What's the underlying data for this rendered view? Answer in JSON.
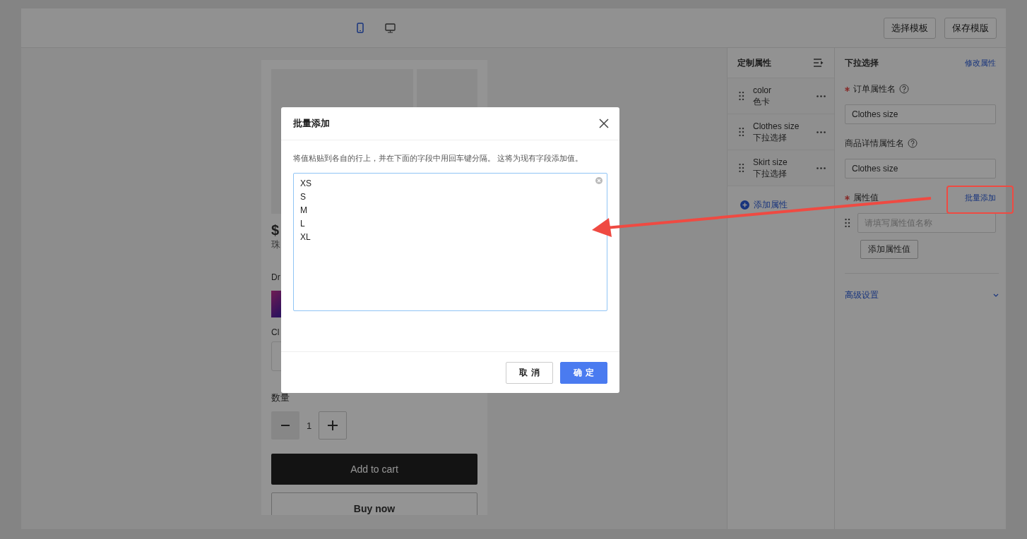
{
  "header": {
    "device_toggle": [
      {
        "kind": "mobile",
        "selected": true
      },
      {
        "kind": "desktop",
        "selected": false
      }
    ],
    "buttons": [
      "选择模板",
      "保存模版"
    ]
  },
  "preview": {
    "price": "$",
    "subtitle": "珠",
    "option_label_1": "Dr",
    "option_label_2": "Cl",
    "quantity_label": "数量",
    "quantity": "1",
    "add_to_cart": "Add to cart",
    "buy_now": "Buy now"
  },
  "attributes_panel": {
    "title": "定制属性",
    "items": [
      {
        "name": "color",
        "type": "色卡"
      },
      {
        "name": "Clothes size",
        "type": "下拉选择"
      },
      {
        "name": "Skirt size",
        "type": "下拉选择"
      }
    ],
    "add_button": "添加属性"
  },
  "settings": {
    "title": "下拉选择",
    "edit_link": "修改属性",
    "fields": [
      {
        "label": "订单属性名",
        "required": true,
        "help": true,
        "value": "Clothes size"
      },
      {
        "label": "商品详情属性名",
        "required": false,
        "help": true,
        "value": "Clothes size"
      }
    ],
    "values_label": "属性值",
    "values_required": true,
    "batch_link": "批量添加",
    "value_placeholder": "请填写属性值名称",
    "add_value_button": "添加属性值",
    "advanced": "高级设置"
  },
  "dialog": {
    "title": "批量添加",
    "description": "将值粘贴到各自的行上，并在下面的字段中用回车键分隔。 这将为现有字段添加值。",
    "textarea_value": "XS\nS\nM\nL\nXL",
    "buttons": [
      {
        "label": "取 消",
        "kind": "secondary"
      },
      {
        "label": "确 定",
        "kind": "primary"
      }
    ]
  }
}
